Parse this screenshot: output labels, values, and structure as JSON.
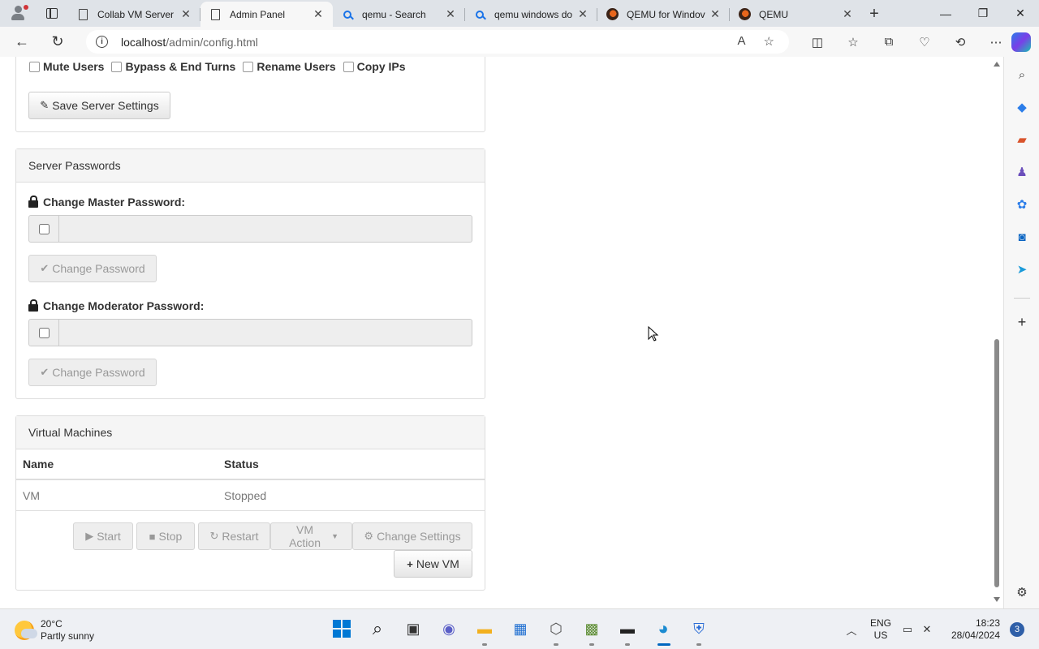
{
  "browser": {
    "tabs": [
      {
        "title": "Collab VM Server",
        "icon": "document-icon"
      },
      {
        "title": "Admin Panel",
        "icon": "document-icon",
        "active": true
      },
      {
        "title": "qemu - Search",
        "icon": "search-icon"
      },
      {
        "title": "qemu windows do",
        "icon": "search-icon"
      },
      {
        "title": "QEMU for Windov",
        "icon": "qemu-icon"
      },
      {
        "title": "QEMU",
        "icon": "qemu-icon"
      }
    ],
    "url_host": "localhost",
    "url_path": "/admin/config.html"
  },
  "permissions": {
    "items": [
      "Mute Users",
      "Bypass & End Turns",
      "Rename Users",
      "Copy IPs"
    ],
    "save_label": "Save Server Settings"
  },
  "passwords": {
    "heading": "Server Passwords",
    "master_label": "Change Master Password:",
    "moderator_label": "Change Moderator Password:",
    "change_button": "Change Password"
  },
  "vms": {
    "heading": "Virtual Machines",
    "columns": [
      "Name",
      "Status"
    ],
    "rows": [
      {
        "name": "VM",
        "status": "Stopped"
      }
    ],
    "actions": {
      "start": "Start",
      "stop": "Stop",
      "restart": "Restart",
      "vm_action": "VM Action",
      "change_settings": "Change Settings",
      "new_vm": "New VM"
    }
  },
  "taskbar": {
    "temperature": "20°C",
    "weather": "Partly sunny",
    "lang_top": "ENG",
    "lang_bottom": "US",
    "time": "18:23",
    "date": "28/04/2024",
    "notifications": "3"
  }
}
